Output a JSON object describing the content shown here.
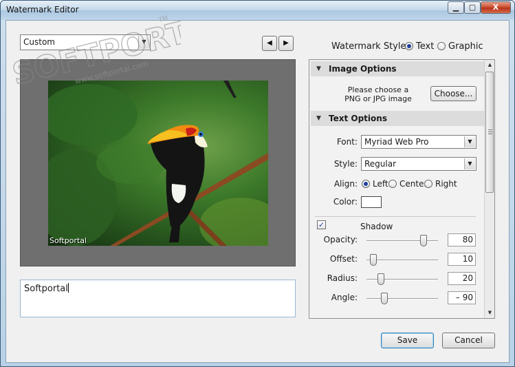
{
  "window": {
    "title": "Watermark Editor",
    "close_label": "X"
  },
  "preset": {
    "value": "Custom"
  },
  "nav": {
    "prev": "◀",
    "next": "▶"
  },
  "watermark_style": {
    "label": "Watermark Style:",
    "options": [
      {
        "label": "Text",
        "selected": true
      },
      {
        "label": "Graphic",
        "selected": false
      }
    ]
  },
  "preview": {
    "watermark_text": "Softportal"
  },
  "text_input": {
    "value": "Softportal"
  },
  "image_options": {
    "header": "Image Options",
    "prompt_line1": "Please choose a",
    "prompt_line2": "PNG or JPG image",
    "choose_label": "Choose..."
  },
  "text_options": {
    "header": "Text Options",
    "font_label": "Font:",
    "font_value": "Myriad Web Pro",
    "style_label": "Style:",
    "style_value": "Regular",
    "align_label": "Align:",
    "align_options": [
      {
        "label": "Left",
        "selected": true
      },
      {
        "label": "Center",
        "selected": false
      },
      {
        "label": "Right",
        "selected": false
      }
    ],
    "color_label": "Color:",
    "color_value": "#ffffff"
  },
  "shadow": {
    "label": "Shadow",
    "checked": true,
    "check_glyph": "✓",
    "opacity": {
      "label": "Opacity:",
      "value": "80",
      "fraction": 0.8
    },
    "offset": {
      "label": "Offset:",
      "value": "10",
      "fraction": 0.1
    },
    "radius": {
      "label": "Radius:",
      "value": "20",
      "fraction": 0.2
    },
    "angle": {
      "label": "Angle:",
      "value": "– 90",
      "fraction": 0.25
    }
  },
  "buttons": {
    "save": "Save",
    "cancel": "Cancel"
  },
  "logo": {
    "text": "SOFTPORTAL",
    "tm": "TM",
    "url": "www.softportal.com"
  }
}
